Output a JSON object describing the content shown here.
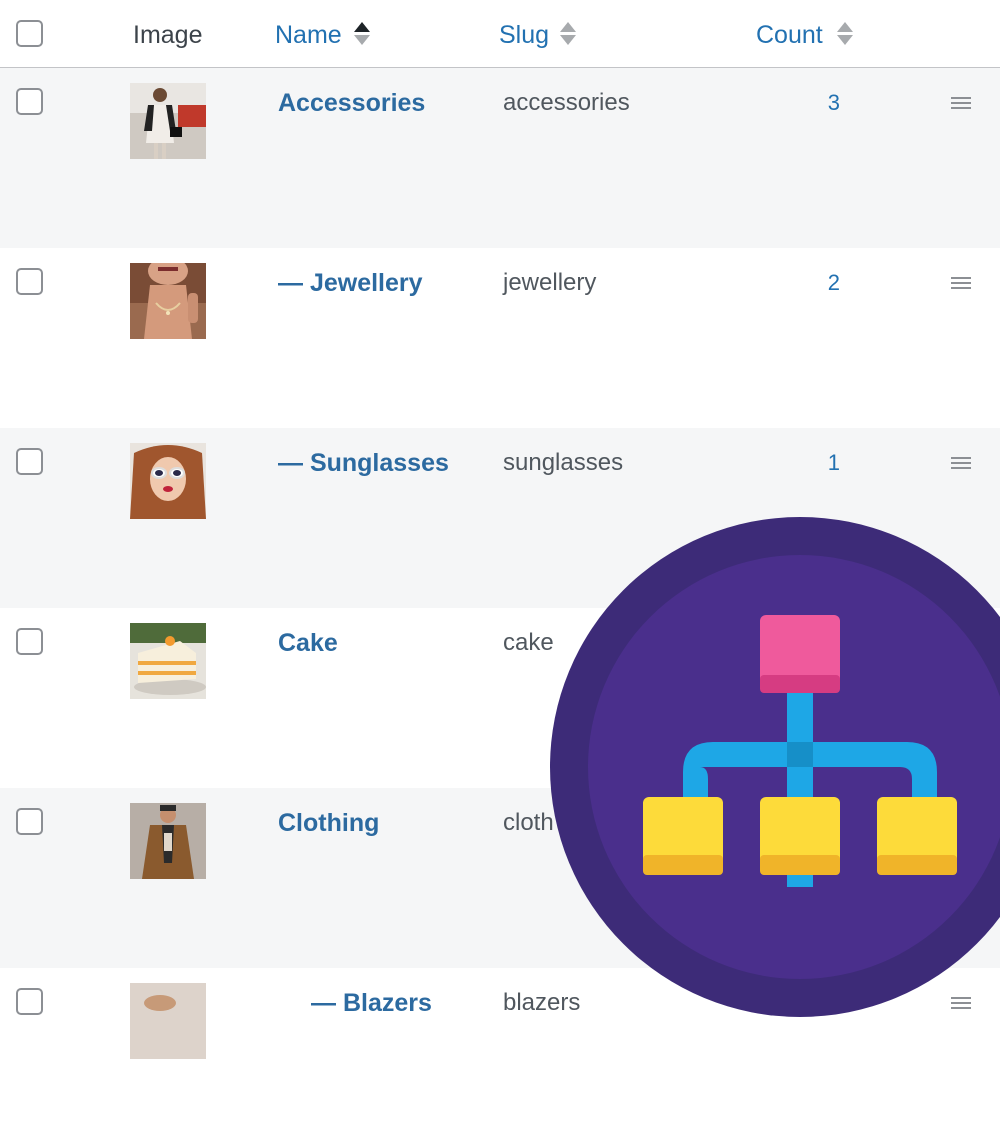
{
  "table": {
    "columns": {
      "image": "Image",
      "name": "Name",
      "slug": "Slug",
      "count": "Count"
    },
    "rows": [
      {
        "name": "Accessories",
        "slug": "accessories",
        "count": "3",
        "thumb": "woman-with-handbag"
      },
      {
        "name": "— Jewellery",
        "slug": "jewellery",
        "count": "2",
        "thumb": "woman-wearing-necklace"
      },
      {
        "name": "— Sunglasses",
        "slug": "sunglasses",
        "count": "1",
        "thumb": "woman-in-sunglasses"
      },
      {
        "name": "Cake",
        "slug": "cake",
        "count": "",
        "thumb": "cake-slice"
      },
      {
        "name": "Clothing",
        "slug": "cloth",
        "count": "",
        "thumb": "man-in-coat"
      },
      {
        "name": "— Blazers",
        "slug": "blazers",
        "count": "",
        "thumb": "blazer-photo"
      }
    ]
  },
  "overlay": {
    "icon": "category-hierarchy-icon",
    "colors": {
      "outer": "#3d2b78",
      "inner": "#4a2f8c",
      "top_node": "#ef5a9c",
      "connector": "#1ea7e6",
      "child_nodes": "#fddb3a",
      "child_shadow": "#f0b429"
    }
  }
}
